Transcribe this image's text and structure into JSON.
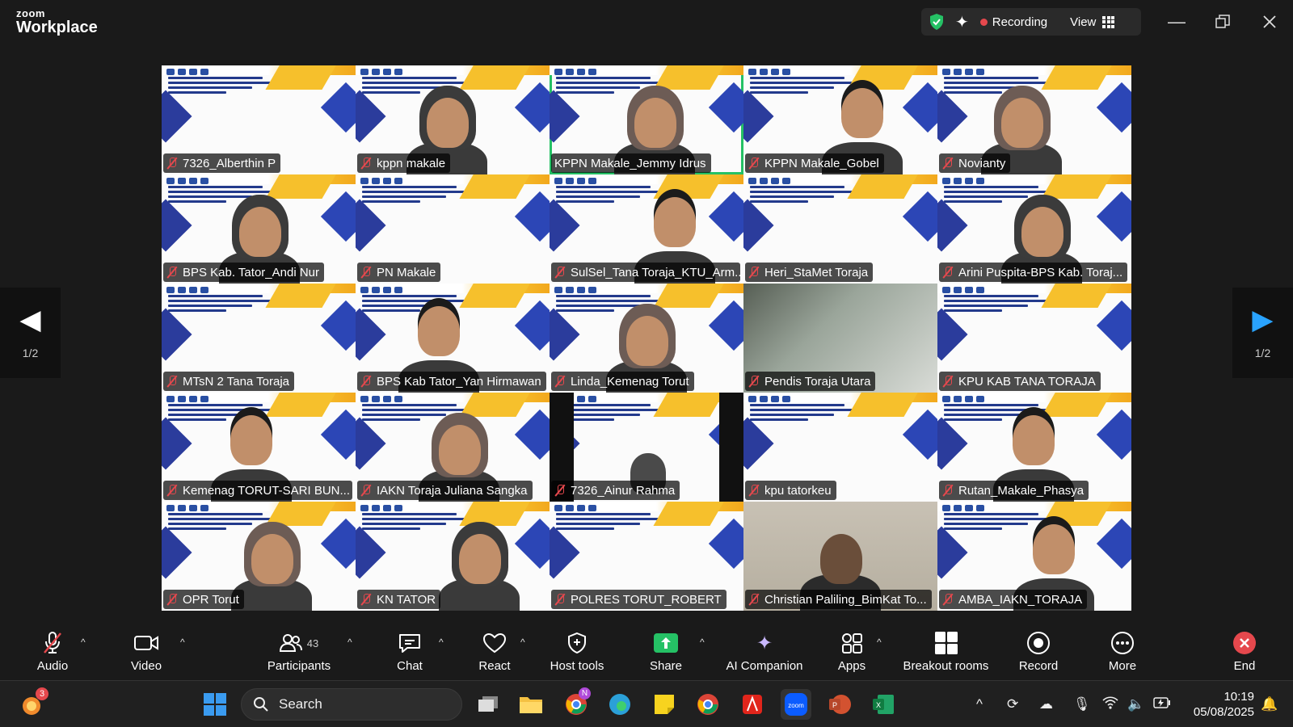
{
  "window": {
    "logo_top": "zoom",
    "logo_bottom": "Workplace",
    "recording_label": "Recording",
    "view_label": "View"
  },
  "gallery": {
    "page_left": "1/2",
    "page_right": "1/2",
    "participants": [
      {
        "name": "7326_Alberthin P",
        "kind": "slide"
      },
      {
        "name": "kppn makale",
        "kind": "slide-person"
      },
      {
        "name": "KPPN Makale_Jemmy Idrus",
        "kind": "slide-person",
        "active": true,
        "muted": false
      },
      {
        "name": "KPPN Makale_Gobel",
        "kind": "slide-person"
      },
      {
        "name": "Novianty",
        "kind": "slide-person"
      },
      {
        "name": "BPS Kab. Tator_Andi Nur",
        "kind": "slide-person"
      },
      {
        "name": "PN Makale",
        "kind": "slide"
      },
      {
        "name": "SulSel_Tana Toraja_KTU_Arm...",
        "kind": "slide-person"
      },
      {
        "name": "Heri_StaMet Toraja",
        "kind": "slide"
      },
      {
        "name": "Arini Puspita-BPS Kab. Toraj...",
        "kind": "slide-person"
      },
      {
        "name": "MTsN 2 Tana Toraja",
        "kind": "slide"
      },
      {
        "name": "BPS Kab Tator_Yan Hirmawan",
        "kind": "slide-person"
      },
      {
        "name": "Linda_Kemenag Torut",
        "kind": "slide-person"
      },
      {
        "name": "Pendis Toraja Utara",
        "kind": "blur"
      },
      {
        "name": "KPU KAB TANA TORAJA",
        "kind": "slide"
      },
      {
        "name": "Kemenag TORUT-SARI BUN...",
        "kind": "slide-person"
      },
      {
        "name": "IAKN Toraja Juliana Sangka",
        "kind": "slide-person"
      },
      {
        "name": "7326_Ainur Rahma",
        "kind": "pillarbox"
      },
      {
        "name": "kpu tatorkeu",
        "kind": "slide"
      },
      {
        "name": "Rutan_Makale_Phasya",
        "kind": "slide-person"
      },
      {
        "name": "OPR Torut",
        "kind": "slide-person"
      },
      {
        "name": "KN TATOR",
        "kind": "slide-person"
      },
      {
        "name": "POLRES TORUT_ROBERT",
        "kind": "slide"
      },
      {
        "name": "Christian Paliling_BimKat To...",
        "kind": "office"
      },
      {
        "name": "AMBA_IAKN_TORAJA",
        "kind": "slide-person"
      }
    ]
  },
  "toolbar": {
    "audio": "Audio",
    "video": "Video",
    "participants": "Participants",
    "participants_count": "43",
    "chat": "Chat",
    "react": "React",
    "host_tools": "Host tools",
    "share": "Share",
    "ai_companion": "AI Companion",
    "apps": "Apps",
    "breakout": "Breakout rooms",
    "record": "Record",
    "more": "More",
    "end": "End"
  },
  "taskbar": {
    "search_label": "Search",
    "notification_badge": "3",
    "chrome_badge": "N",
    "time": "10:19",
    "date": "05/08/2025"
  },
  "colors": {
    "active_speaker": "#25c165",
    "muted": "#e5484d",
    "share_green": "#25c165",
    "end_red": "#e5484d"
  }
}
